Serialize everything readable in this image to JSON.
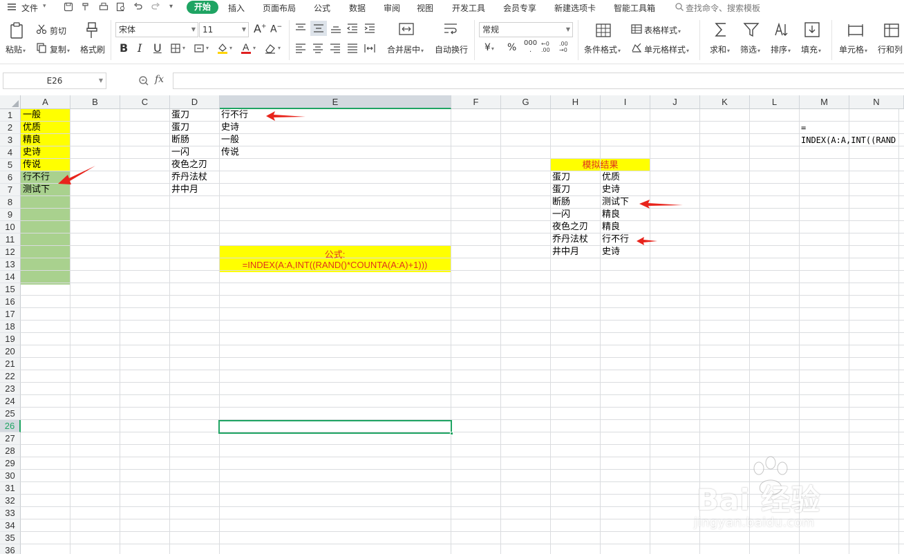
{
  "menubar": {
    "file_label": "文件",
    "tabs": [
      "开始",
      "插入",
      "页面布局",
      "公式",
      "数据",
      "审阅",
      "视图",
      "开发工具",
      "会员专享",
      "新建选项卡",
      "智能工具箱"
    ],
    "active_tab": "开始",
    "search_placeholder": "查找命令、搜索模板"
  },
  "ribbon": {
    "paste": "粘贴",
    "cut": "剪切",
    "copy": "复制",
    "format_painter": "格式刷",
    "font_name": "宋体",
    "font_size": "11",
    "merge_center": "合并居中",
    "wrap_text": "自动换行",
    "number_format": "常规",
    "currency_symbol": "¥",
    "percent_symbol": "%",
    "thousands": "000",
    "conditional_format": "条件格式",
    "table_style": "表格样式",
    "cell_style": "单元格样式",
    "sum": "求和",
    "filter": "筛选",
    "sort": "排序",
    "fill": "填充",
    "cell": "单元格",
    "row_col": "行和列"
  },
  "formula_bar": {
    "name_box": "E26",
    "fx": "fx",
    "formula": ""
  },
  "grid": {
    "columns": [
      "A",
      "B",
      "C",
      "D",
      "E",
      "F",
      "G",
      "H",
      "I",
      "J",
      "K",
      "L",
      "M",
      "N"
    ],
    "selected_column": "E",
    "selected_row": "26",
    "rows": [
      "1",
      "2",
      "3",
      "4",
      "5",
      "6",
      "7",
      "8",
      "9",
      "10",
      "11",
      "12",
      "13",
      "14",
      "15",
      "16",
      "17",
      "18",
      "19",
      "20",
      "21",
      "22",
      "23",
      "24",
      "25",
      "26",
      "27",
      "28",
      "29",
      "30",
      "31",
      "32",
      "33",
      "34",
      "35",
      "36"
    ],
    "col_a": [
      "一般",
      "优质",
      "精良",
      "史诗",
      "传说",
      "行不行",
      "测试下"
    ],
    "col_d": [
      "蛋刀",
      "蛋刀",
      "断肠",
      "一闪",
      "夜色之刃",
      "乔丹法杖",
      "井中月"
    ],
    "col_e": [
      "行不行",
      "史诗",
      "一般",
      "传说"
    ],
    "formula_note": {
      "label": "公式:",
      "formula": "=INDEX(A:A,INT((RAND()*COUNTA(A:A)+1)))"
    },
    "sim_result": {
      "title": "模拟结果",
      "rows": [
        [
          "蛋刀",
          "优质"
        ],
        [
          "蛋刀",
          "史诗"
        ],
        [
          "断肠",
          "测试下"
        ],
        [
          "一闪",
          "精良"
        ],
        [
          "夜色之刃",
          "精良"
        ],
        [
          "乔丹法杖",
          "行不行"
        ],
        [
          "井中月",
          "史诗"
        ]
      ]
    },
    "col_m": [
      "=",
      "INDEX(A:A,INT((RAND"
    ]
  },
  "colors": {
    "accent": "#1fa463",
    "yellow_fill": "#ffff00",
    "green_fill": "#a9d18e",
    "note_red": "#e0321c"
  },
  "watermark": {
    "brand": "Bai 经验",
    "url": "jingyan.baidu.com"
  }
}
